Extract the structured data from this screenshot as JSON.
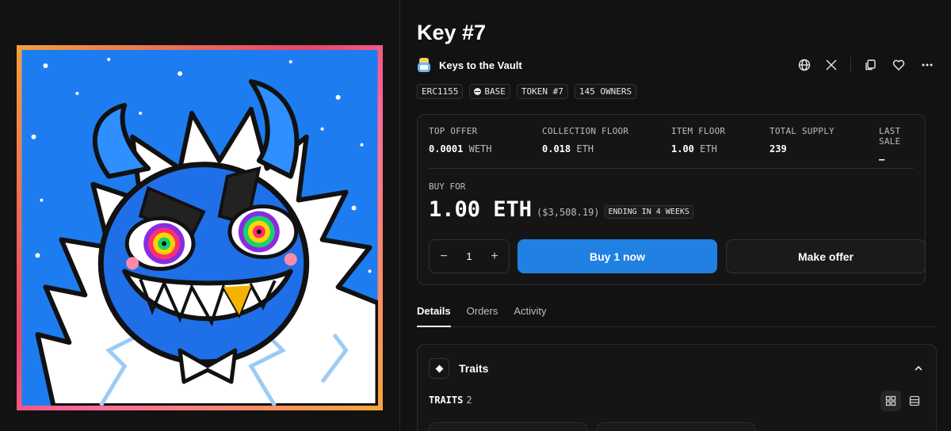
{
  "item": {
    "title": "Key #7",
    "collection_name": "Keys to the Vault",
    "badges": [
      "ERC1155",
      "BASE",
      "TOKEN #7",
      "145 OWNERS"
    ]
  },
  "actions": {
    "icons": [
      "globe-icon",
      "x-icon",
      "copy-icon",
      "heart-icon",
      "more-icon"
    ]
  },
  "stats": [
    {
      "label": "TOP OFFER",
      "value": "0.0001",
      "unit": "WETH"
    },
    {
      "label": "COLLECTION FLOOR",
      "value": "0.018",
      "unit": "ETH"
    },
    {
      "label": "ITEM FLOOR",
      "value": "1.00",
      "unit": "ETH"
    },
    {
      "label": "TOTAL SUPPLY",
      "value": "239",
      "unit": ""
    },
    {
      "label": "LAST SALE",
      "value": "–",
      "unit": ""
    }
  ],
  "buy": {
    "label": "BUY FOR",
    "price": "1.00 ETH",
    "usd": "($3,508.19)",
    "ending": "ENDING IN 4 WEEKS",
    "quantity": "1",
    "minus": "−",
    "plus": "+",
    "buy_button": "Buy 1 now",
    "offer_button": "Make offer"
  },
  "tabs": [
    "Details",
    "Orders",
    "Activity"
  ],
  "traits": {
    "title": "Traits",
    "label": "TRAITS",
    "count": "2"
  },
  "colors": {
    "accent": "#2081e2",
    "background": "#121212",
    "art_sky": "#1d7df0"
  }
}
